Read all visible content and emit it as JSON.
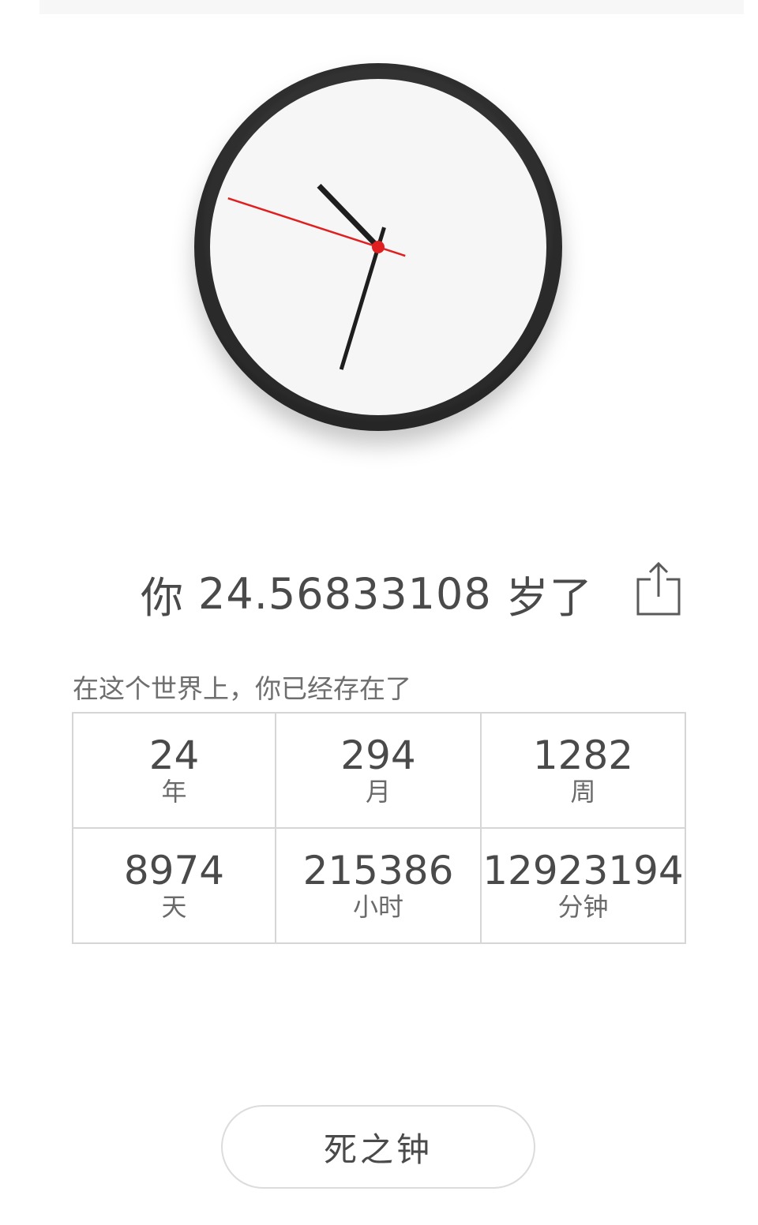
{
  "age": {
    "prefix": "你",
    "value": "24.56833108",
    "suffix": "岁了"
  },
  "share": {
    "icon": "share-icon"
  },
  "clock": {
    "time": {
      "hour": 10,
      "minute": 32,
      "second": 48
    },
    "colors": {
      "rim": "#2e2e2e",
      "face": "#f6f6f6",
      "hand": "#1e1e1e",
      "second_hand": "#e02020"
    }
  },
  "existed": {
    "label": "在这个世界上，你已经存在了",
    "stats": [
      {
        "value": "24",
        "unit": "年"
      },
      {
        "value": "294",
        "unit": "月"
      },
      {
        "value": "1282",
        "unit": "周"
      },
      {
        "value": "8974",
        "unit": "天"
      },
      {
        "value": "215386",
        "unit": "小时"
      },
      {
        "value": "12923194",
        "unit": "分钟"
      }
    ]
  },
  "death_clock_button": {
    "label": "死之钟"
  }
}
